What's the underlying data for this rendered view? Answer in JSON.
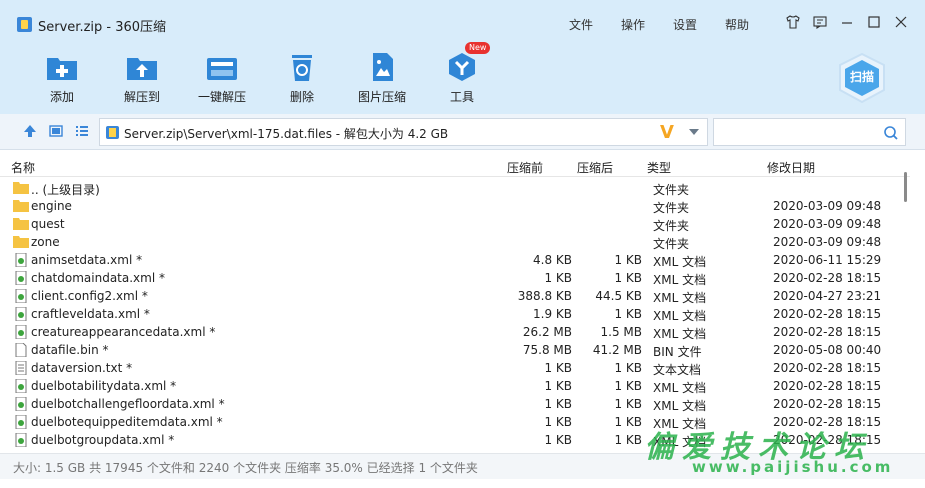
{
  "window": {
    "title": "Server.zip - 360压缩",
    "menu": [
      "文件",
      "操作",
      "设置",
      "帮助"
    ]
  },
  "toolbar": {
    "items": [
      {
        "label": "添加",
        "icon": "add-icon"
      },
      {
        "label": "解压到",
        "icon": "extract-to-icon"
      },
      {
        "label": "一键解压",
        "icon": "one-click-extract-icon"
      },
      {
        "label": "删除",
        "icon": "delete-icon"
      },
      {
        "label": "图片压缩",
        "icon": "image-compress-icon"
      },
      {
        "label": "工具",
        "icon": "tools-icon"
      }
    ],
    "new_badge": "New",
    "scan_label": "扫描"
  },
  "address": {
    "path": "Server.zip\\Server\\xml-175.dat.files - 解包大小为 4.2 GB",
    "logo": "V",
    "search_placeholder": ""
  },
  "columns": {
    "name": "名称",
    "size": "压缩前",
    "compressed": "压缩后",
    "type": "类型",
    "modified": "修改日期"
  },
  "files": [
    {
      "name": ".. (上级目录)",
      "size": "",
      "compressed": "",
      "type": "文件夹",
      "date": "",
      "kind": "folder"
    },
    {
      "name": "engine",
      "size": "",
      "compressed": "",
      "type": "文件夹",
      "date": "2020-03-09 09:48",
      "kind": "folder"
    },
    {
      "name": "quest",
      "size": "",
      "compressed": "",
      "type": "文件夹",
      "date": "2020-03-09 09:48",
      "kind": "folder"
    },
    {
      "name": "zone",
      "size": "",
      "compressed": "",
      "type": "文件夹",
      "date": "2020-03-09 09:48",
      "kind": "folder"
    },
    {
      "name": "animsetdata.xml *",
      "size": "4.8 KB",
      "compressed": "1 KB",
      "type": "XML 文档",
      "date": "2020-06-11 15:29",
      "kind": "xml"
    },
    {
      "name": "chatdomaindata.xml *",
      "size": "1 KB",
      "compressed": "1 KB",
      "type": "XML 文档",
      "date": "2020-02-28 18:15",
      "kind": "xml"
    },
    {
      "name": "client.config2.xml *",
      "size": "388.8 KB",
      "compressed": "44.5 KB",
      "type": "XML 文档",
      "date": "2020-04-27 23:21",
      "kind": "xml"
    },
    {
      "name": "craftleveldata.xml *",
      "size": "1.9 KB",
      "compressed": "1 KB",
      "type": "XML 文档",
      "date": "2020-02-28 18:15",
      "kind": "xml"
    },
    {
      "name": "creatureappearancedata.xml *",
      "size": "26.2 MB",
      "compressed": "1.5 MB",
      "type": "XML 文档",
      "date": "2020-02-28 18:15",
      "kind": "xml"
    },
    {
      "name": "datafile.bin *",
      "size": "75.8 MB",
      "compressed": "41.2 MB",
      "type": "BIN 文件",
      "date": "2020-05-08 00:40",
      "kind": "file"
    },
    {
      "name": "dataversion.txt *",
      "size": "1 KB",
      "compressed": "1 KB",
      "type": "文本文档",
      "date": "2020-02-28 18:15",
      "kind": "txt"
    },
    {
      "name": "duelbotabilitydata.xml *",
      "size": "1 KB",
      "compressed": "1 KB",
      "type": "XML 文档",
      "date": "2020-02-28 18:15",
      "kind": "xml"
    },
    {
      "name": "duelbotchallengefloordata.xml *",
      "size": "1 KB",
      "compressed": "1 KB",
      "type": "XML 文档",
      "date": "2020-02-28 18:15",
      "kind": "xml"
    },
    {
      "name": "duelbotequippeditemdata.xml *",
      "size": "1 KB",
      "compressed": "1 KB",
      "type": "XML 文档",
      "date": "2020-02-28 18:15",
      "kind": "xml"
    },
    {
      "name": "duelbotgroupdata.xml *",
      "size": "1 KB",
      "compressed": "1 KB",
      "type": "XML 文档",
      "date": "2020-02-28 18:15",
      "kind": "xml"
    }
  ],
  "status": {
    "text": "大小: 1.5 GB 共 17945 个文件和 2240 个文件夹 压缩率 35.0% 已经选择 1 个文件夹"
  },
  "watermark": {
    "cn": "偏爱技术论坛",
    "url": "www.paijishu.com"
  },
  "colors": {
    "titlebar": "#d8ecfa",
    "accent": "#2f86d6",
    "folder": "#f5c342",
    "watermark": "#2bb24c"
  }
}
